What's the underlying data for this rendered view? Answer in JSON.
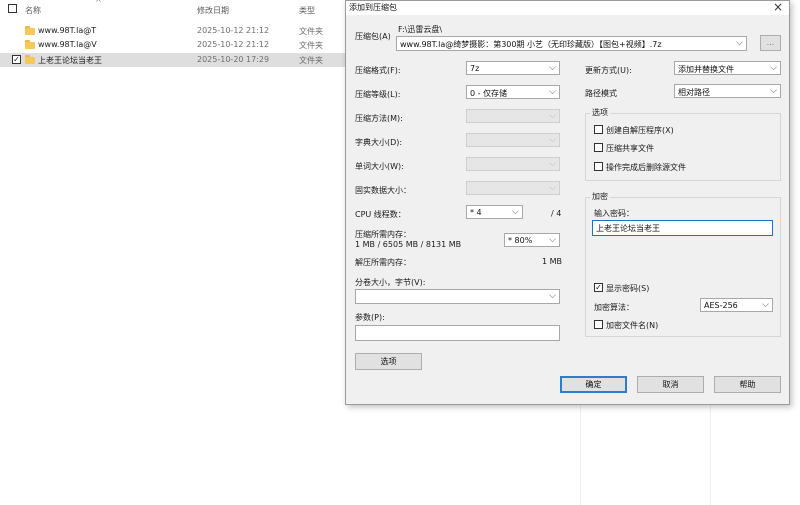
{
  "explorer": {
    "columns": {
      "name": "名称",
      "modified": "修改日期",
      "type": "类型"
    },
    "rows": [
      {
        "name": "www.98T.la@T",
        "date": "2025-10-12 21:12",
        "type": "文件夹",
        "checked": ""
      },
      {
        "name": "www.98T.la@V",
        "date": "2025-10-12 21:12",
        "type": "文件夹",
        "checked": ""
      },
      {
        "name": "上老王论坛当老王",
        "date": "2025-10-20 17:29",
        "type": "文件夹",
        "checked": "✓"
      }
    ]
  },
  "dialog": {
    "title": "添加到压缩包",
    "archive_label": "压缩包(A)",
    "archive_path": "F:\\迅雷云盘\\",
    "archive_name": "www.98T.la@绮梦摄影：第300期 小艺（无印珍藏版）【图包+视频】.7z",
    "browse_label": "...",
    "left": {
      "format_label": "压缩格式(F):",
      "format_value": "7z",
      "level_label": "压缩等级(L):",
      "level_value": "0 - 仅存储",
      "method_label": "压缩方法(M):",
      "dict_label": "字典大小(D):",
      "word_label": "单词大小(W):",
      "solid_label": "固实数据大小：",
      "threads_label": "CPU 线程数：",
      "threads_value": "* 4",
      "threads_max": "/ 4",
      "mem_comp_label": "压缩所需内存：",
      "mem_comp_detail": "1 MB / 6505 MB / 8131 MB",
      "mem_comp_value": "* 80%",
      "mem_decomp_label": "解压所需内存：",
      "mem_decomp_value": "1 MB",
      "split_label": "分卷大小，字节(V):",
      "params_label": "参数(P):",
      "options_button": "选项"
    },
    "right": {
      "update_label": "更新方式(U):",
      "update_value": "添加并替换文件",
      "path_label": "路径模式",
      "path_value": "相对路径",
      "options_group": "选项",
      "opt_sfx": "创建自解压程序(X)",
      "opt_shared": "压缩共享文件",
      "opt_delete": "操作完成后删除源文件",
      "encrypt_group": "加密",
      "password_label": "输入密码：",
      "password_value": "上老王论坛当老王",
      "show_password": "显示密码(S)",
      "show_password_check": "✓",
      "enc_method_label": "加密算法：",
      "enc_method_value": "AES-256",
      "encrypt_names": "加密文件名(N)"
    },
    "buttons": {
      "ok": "确定",
      "cancel": "取消",
      "help": "帮助"
    }
  }
}
